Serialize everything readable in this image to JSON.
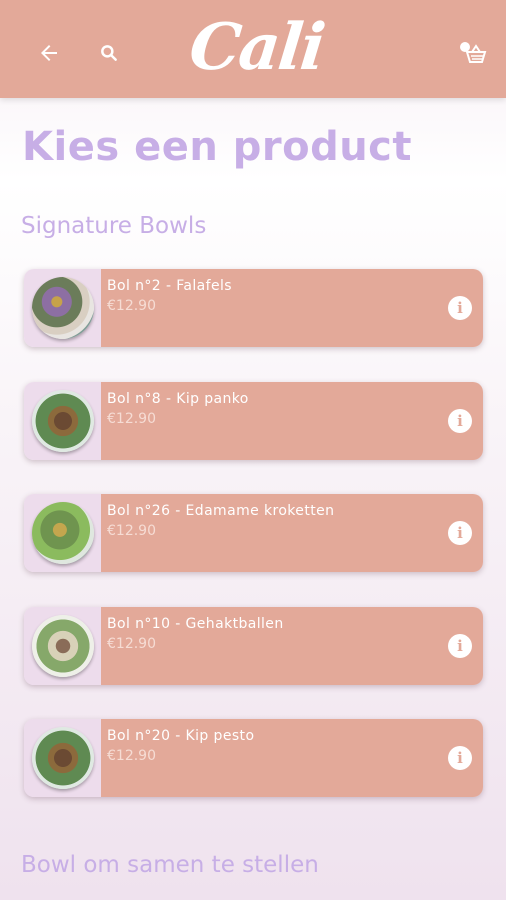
{
  "header": {
    "logo_text": "Cali",
    "back_icon": "arrow-left-icon",
    "search_icon": "search-icon",
    "cart_icon": "basket-icon",
    "background_color": "#e3a999"
  },
  "page_title": "Kies een product",
  "sections": [
    {
      "title": "Signature Bowls",
      "products": [
        {
          "name": "Bol n°2 - Falafels",
          "price": "€12.90",
          "image": "falafel-bowl"
        },
        {
          "name": "Bol n°8 - Kip panko",
          "price": "€12.90",
          "image": "chicken-panko-bowl"
        },
        {
          "name": "Bol n°26 - Edamame kroketten",
          "price": "€12.90",
          "image": "edamame-bowl"
        },
        {
          "name": "Bol n°10 - Gehaktballen",
          "price": "€12.90",
          "image": "meatball-bowl"
        },
        {
          "name": "Bol n°20 - Kip pesto",
          "price": "€12.90",
          "image": "chicken-pesto-bowl"
        }
      ]
    },
    {
      "title": "Bowl om samen te stellen",
      "products": []
    }
  ],
  "colors": {
    "accent": "#e3a999",
    "title": "#c7aee6"
  }
}
